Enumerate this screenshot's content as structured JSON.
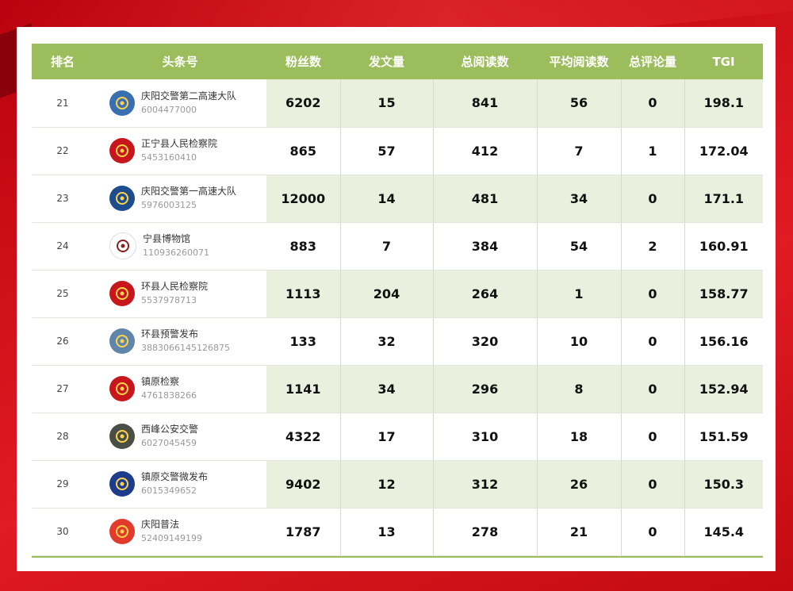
{
  "headers": {
    "rank": "排名",
    "account": "头条号",
    "fans": "粉丝数",
    "posts": "发文量",
    "total_reads": "总阅读数",
    "avg_reads": "平均阅读数",
    "comments": "总评论量",
    "tgi": "TGI"
  },
  "rows": [
    {
      "rank": "21",
      "name": "庆阳交警第二高速大队",
      "id": "6004477000",
      "fans": "6202",
      "posts": "15",
      "total_reads": "841",
      "avg_reads": "56",
      "comments": "0",
      "tgi": "198.1",
      "icon": "police-badge-icon",
      "color": "#3a6fb0"
    },
    {
      "rank": "22",
      "name": "正宁县人民检察院",
      "id": "5453160410",
      "fans": "865",
      "posts": "57",
      "total_reads": "412",
      "avg_reads": "7",
      "comments": "1",
      "tgi": "172.04",
      "icon": "national-emblem-icon",
      "color": "#c8161d"
    },
    {
      "rank": "23",
      "name": "庆阳交警第一高速大队",
      "id": "5976003125",
      "fans": "12000",
      "posts": "14",
      "total_reads": "481",
      "avg_reads": "34",
      "comments": "0",
      "tgi": "171.1",
      "icon": "police-badge-icon",
      "color": "#1d4d8c"
    },
    {
      "rank": "24",
      "name": "宁县博物馆",
      "id": "110936260071",
      "fans": "883",
      "posts": "7",
      "total_reads": "384",
      "avg_reads": "54",
      "comments": "2",
      "tgi": "160.91",
      "icon": "museum-logo-icon",
      "color": "#ffffff"
    },
    {
      "rank": "25",
      "name": "环县人民检察院",
      "id": "5537978713",
      "fans": "1113",
      "posts": "204",
      "total_reads": "264",
      "avg_reads": "1",
      "comments": "0",
      "tgi": "158.77",
      "icon": "national-emblem-icon",
      "color": "#c8161d"
    },
    {
      "rank": "26",
      "name": "环县预警发布",
      "id": "3883066145126875",
      "fans": "133",
      "posts": "32",
      "total_reads": "320",
      "avg_reads": "10",
      "comments": "0",
      "tgi": "156.16",
      "icon": "weather-photo-icon",
      "color": "#5f86a8"
    },
    {
      "rank": "27",
      "name": "镇原检察",
      "id": "4761838266",
      "fans": "1141",
      "posts": "34",
      "total_reads": "296",
      "avg_reads": "8",
      "comments": "0",
      "tgi": "152.94",
      "icon": "national-emblem-icon",
      "color": "#c8161d"
    },
    {
      "rank": "28",
      "name": "西峰公安交警",
      "id": "6027045459",
      "fans": "4322",
      "posts": "17",
      "total_reads": "310",
      "avg_reads": "18",
      "comments": "0",
      "tgi": "151.59",
      "icon": "team-photo-icon",
      "color": "#4a4f45"
    },
    {
      "rank": "29",
      "name": "镇原交警微发布",
      "id": "6015349652",
      "fans": "9402",
      "posts": "12",
      "total_reads": "312",
      "avg_reads": "26",
      "comments": "0",
      "tgi": "150.3",
      "icon": "police-badge-icon",
      "color": "#1e3c8c"
    },
    {
      "rank": "30",
      "name": "庆阳普法",
      "id": "52409149199",
      "fans": "1787",
      "posts": "13",
      "total_reads": "278",
      "avg_reads": "21",
      "comments": "0",
      "tgi": "145.4",
      "icon": "law-logo-icon",
      "color": "#e23a2c"
    }
  ],
  "colors": {
    "header": "#9cbd5b",
    "alt_row": "#e9f0dd",
    "background": "#d4131c"
  }
}
